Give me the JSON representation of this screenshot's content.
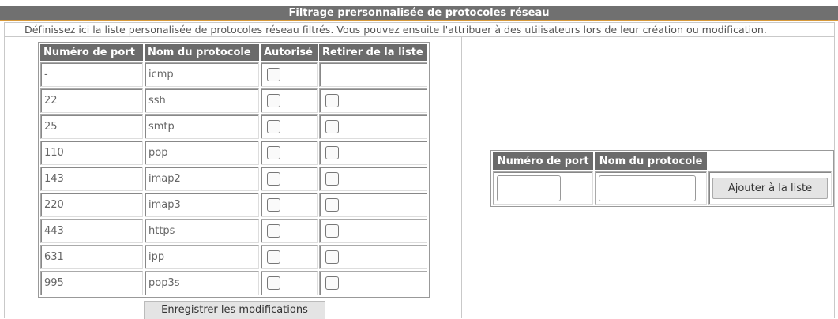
{
  "header": {
    "title": "Filtrage prersonnalisée de protocoles réseau",
    "description": "Définissez ici la liste personalisée de protocoles réseau filtrés. Vous pouvez ensuite l'attribuer à des utilisateurs lors de leur création ou modification."
  },
  "list": {
    "columns": [
      "Numéro de port",
      "Nom du protocole",
      "Autorisé",
      "Retirer de la liste"
    ],
    "rows": [
      {
        "port": "-",
        "name": "icmp",
        "authorized": false,
        "removable": false
      },
      {
        "port": "22",
        "name": "ssh",
        "authorized": false,
        "removable": true
      },
      {
        "port": "25",
        "name": "smtp",
        "authorized": false,
        "removable": true
      },
      {
        "port": "110",
        "name": "pop",
        "authorized": false,
        "removable": true
      },
      {
        "port": "143",
        "name": "imap2",
        "authorized": false,
        "removable": true
      },
      {
        "port": "220",
        "name": "imap3",
        "authorized": false,
        "removable": true
      },
      {
        "port": "443",
        "name": "https",
        "authorized": false,
        "removable": true
      },
      {
        "port": "631",
        "name": "ipp",
        "authorized": false,
        "removable": true
      },
      {
        "port": "995",
        "name": "pop3s",
        "authorized": false,
        "removable": true
      }
    ],
    "save_label": "Enregistrer les modifications"
  },
  "add_form": {
    "port_header": "Numéro de port",
    "name_header": "Nom du protocole",
    "port_value": "",
    "name_value": "",
    "add_label": "Ajouter à la liste"
  }
}
